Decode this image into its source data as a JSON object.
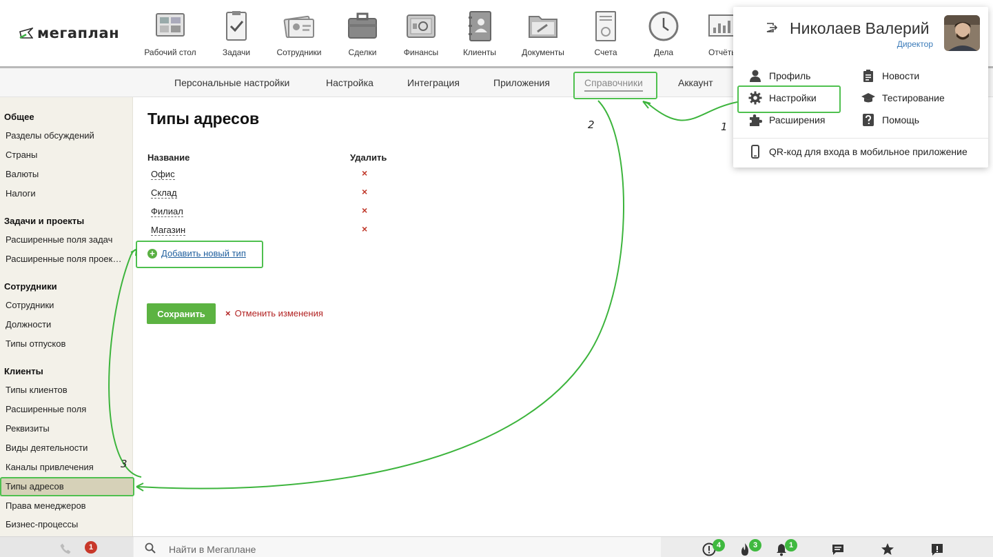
{
  "brand": {
    "name": "мегаплан"
  },
  "nav": {
    "items": [
      {
        "label": "Рабочий стол",
        "icon": "desktop-icon"
      },
      {
        "label": "Задачи",
        "icon": "tasks-icon"
      },
      {
        "label": "Сотрудники",
        "icon": "employees-icon"
      },
      {
        "label": "Сделки",
        "icon": "deals-icon"
      },
      {
        "label": "Финансы",
        "icon": "finance-icon"
      },
      {
        "label": "Клиенты",
        "icon": "clients-icon"
      },
      {
        "label": "Документы",
        "icon": "documents-icon"
      },
      {
        "label": "Счета",
        "icon": "invoices-icon"
      },
      {
        "label": "Дела",
        "icon": "clock-icon"
      },
      {
        "label": "Отчёты",
        "icon": "reports-icon"
      }
    ]
  },
  "subnav": {
    "items": [
      "Персональные настройки",
      "Настройка",
      "Интеграция",
      "Приложения",
      "Справочники",
      "Аккаунт"
    ],
    "active": "Справочники"
  },
  "sidebar": {
    "groups": [
      {
        "title": "Общее",
        "items": [
          "Разделы обсуждений",
          "Страны",
          "Валюты",
          "Налоги"
        ]
      },
      {
        "title": "Задачи и проекты",
        "items": [
          "Расширенные поля задач",
          "Расширенные поля проектов"
        ]
      },
      {
        "title": "Сотрудники",
        "items": [
          "Сотрудники",
          "Должности",
          "Типы отпусков"
        ]
      },
      {
        "title": "Клиенты",
        "items": [
          "Типы клиентов",
          "Расширенные поля",
          "Реквизиты",
          "Виды деятельности",
          "Каналы привлечения",
          "Типы адресов",
          "Права менеджеров",
          "Бизнес-процессы"
        ]
      }
    ],
    "selected": "Типы адресов"
  },
  "main": {
    "title": "Типы адресов",
    "col_name": "Название",
    "col_delete": "Удалить",
    "rows": [
      "Офис",
      "Склад",
      "Филиал",
      "Магазин"
    ],
    "delete_glyph": "×",
    "add_label": "Добавить новый тип",
    "save_label": "Сохранить",
    "cancel_label": "Отменить изменения"
  },
  "bottombar": {
    "search_placeholder": "Найти в Мегаплане",
    "calls_badge": "1",
    "alerts_badge": "4",
    "hot_badge": "3",
    "notif_badge": "1"
  },
  "user_menu": {
    "name": "Николаев Валерий",
    "role": "Директор",
    "items": [
      {
        "label": "Профиль",
        "icon": "person-icon"
      },
      {
        "label": "Новости",
        "icon": "clipboard-icon"
      },
      {
        "label": "Настройки",
        "icon": "gear-icon"
      },
      {
        "label": "Тестирование",
        "icon": "graduation-cap-icon"
      },
      {
        "label": "Расширения",
        "icon": "puzzle-icon"
      },
      {
        "label": "Помощь",
        "icon": "question-icon"
      }
    ],
    "qr_label": "QR-код для входа в мобильное приложение"
  },
  "annotations": {
    "step1": "1",
    "step2": "2",
    "step3": "3",
    "color": "#3cb43c"
  },
  "colors": {
    "accent": "#5cb342",
    "sidebar_bg": "#f3f1e9",
    "selected_bg": "#d6d1b8",
    "link": "#1f5f9e",
    "danger": "#b22222"
  }
}
